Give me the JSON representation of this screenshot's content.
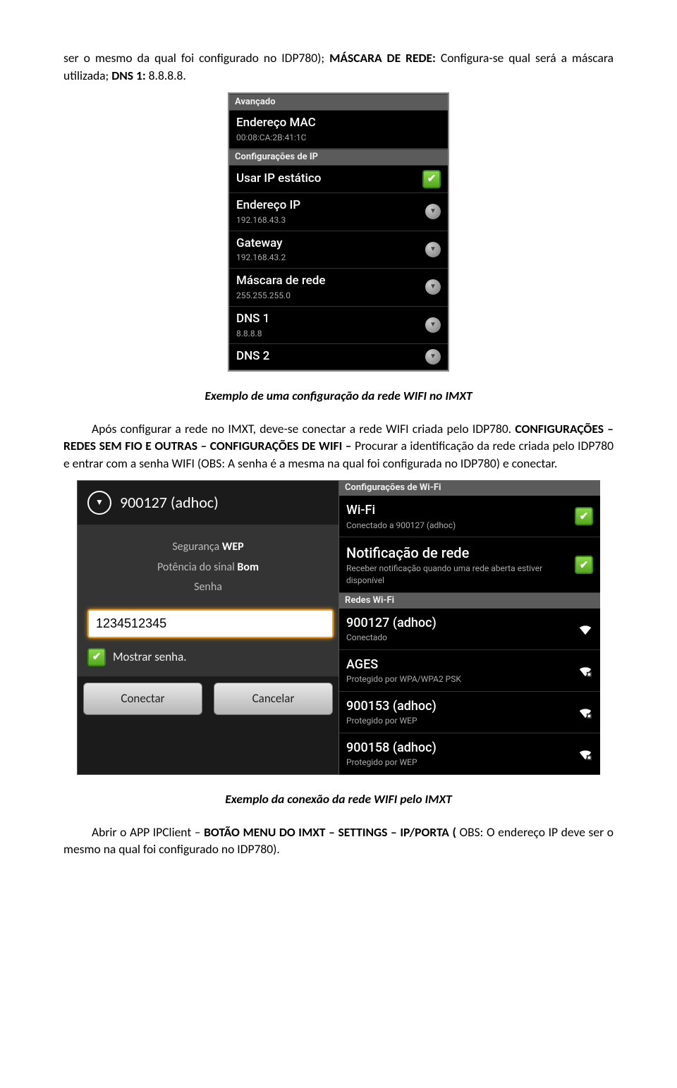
{
  "intro": {
    "p1_a": "ser o mesmo da qual foi configurado no IDP780); ",
    "p1_b": "MÁSCARA DE REDE:",
    "p1_c": " Configura-se qual será a máscara utilizada; ",
    "p1_d": "DNS 1:",
    "p1_e": " 8.8.8.8."
  },
  "shot1": {
    "hdr_avancado": "Avançado",
    "mac_title": "Endereço MAC",
    "mac_value": "00:08:CA:2B:41:1C",
    "hdr_ip": "Configurações de IP",
    "static_ip": "Usar IP estático",
    "ip_title": "Endereço IP",
    "ip_value": "192.168.43.3",
    "gw_title": "Gateway",
    "gw_value": "192.168.43.2",
    "mask_title": "Máscara de rede",
    "mask_value": "255.255.255.0",
    "dns1_title": "DNS 1",
    "dns1_value": "8.8.8.8",
    "dns2_title": "DNS 2"
  },
  "caption1": "Exemplo de uma configuração da rede WIFI no IMXT",
  "para2": {
    "a": "Após configurar a rede no IMXT, deve-se conectar a rede WIFI criada pelo IDP780. ",
    "b": "CONFIGURAÇÕES – REDES SEM FIO E OUTRAS – CONFIGURAÇÕES DE WIFI – ",
    "c": "Procurar a identificação da rede criada pelo IDP780 e entrar com a senha WIFI (OBS: A senha é a mesma na qual foi configurada no IDP780) e conectar."
  },
  "popup": {
    "title": "900127 (adhoc)",
    "seg_lbl": "Segurança",
    "seg_val": "WEP",
    "pot_lbl": "Potência do sinal",
    "pot_val": "Bom",
    "senha_lbl": "Senha",
    "pw_value": "1234512345",
    "show_pw": "Mostrar senha.",
    "connect": "Conectar",
    "cancel": "Cancelar"
  },
  "wifi": {
    "hdr": "Configurações de Wi-Fi",
    "wifi_title": "Wi-Fi",
    "wifi_sub": "Conectado a 900127 (adhoc)",
    "notif_title": "Notificação de rede",
    "notif_sub": "Receber notificação quando uma rede aberta estiver disponível",
    "hdr_redes": "Redes Wi-Fi",
    "net1_title": "900127 (adhoc)",
    "net1_sub": "Conectado",
    "net2_title": "AGES",
    "net2_sub": "Protegido por WPA/WPA2 PSK",
    "net3_title": "900153 (adhoc)",
    "net3_sub": "Protegido por WEP",
    "net4_title": "900158 (adhoc)",
    "net4_sub": "Protegido por WEP"
  },
  "caption2": "Exemplo da conexão da rede WIFI pelo IMXT",
  "para3": {
    "a": "Abrir o APP IPClient – ",
    "b": "BOTÃO MENU DO IMXT – SETTINGS – IP/PORTA (",
    "c": "OBS: O endereço IP deve ser o mesmo na qual foi configurado no IDP780)."
  }
}
